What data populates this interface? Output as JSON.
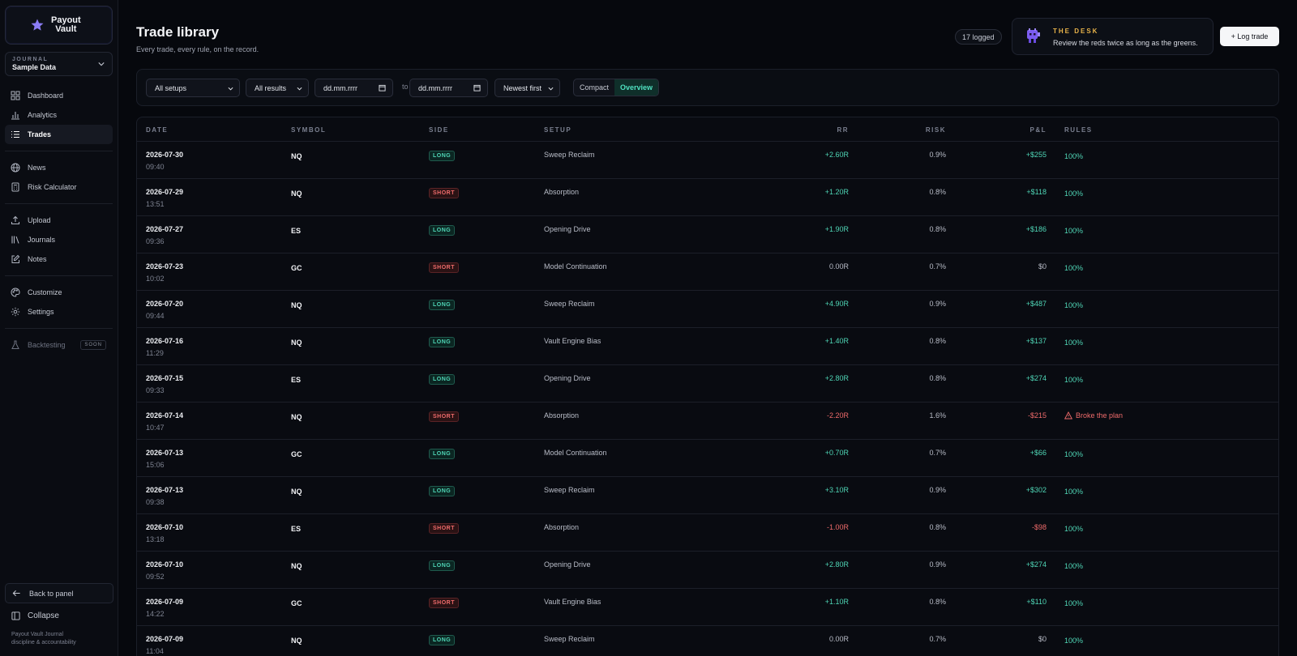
{
  "brand": {
    "line1": "Payout",
    "line2": "Vault"
  },
  "journal": {
    "label": "JOURNAL",
    "value": "Sample Data"
  },
  "nav": {
    "group1": [
      {
        "label": "Dashboard",
        "icon": "grid-icon"
      },
      {
        "label": "Analytics",
        "icon": "bar-chart-icon"
      },
      {
        "label": "Trades",
        "icon": "list-icon",
        "active": true
      }
    ],
    "group2": [
      {
        "label": "News",
        "icon": "globe-icon"
      },
      {
        "label": "Risk Calculator",
        "icon": "calculator-icon"
      }
    ],
    "group3": [
      {
        "label": "Upload",
        "icon": "upload-icon"
      },
      {
        "label": "Journals",
        "icon": "books-icon"
      },
      {
        "label": "Notes",
        "icon": "note-edit-icon"
      }
    ],
    "group4": [
      {
        "label": "Customize",
        "icon": "palette-icon"
      },
      {
        "label": "Settings",
        "icon": "gear-icon"
      }
    ],
    "backtesting": {
      "label": "Backtesting",
      "badge": "SOON"
    }
  },
  "back_label": "Back to panel",
  "collapse_label": "Collapse",
  "footer": {
    "line1": "Payout Vault Journal",
    "line2": "discipline & accountability"
  },
  "header": {
    "title": "Trade library",
    "subtitle": "Every trade, every rule, on the record.",
    "logged": "17 logged",
    "desk_title": "THE DESK",
    "desk_msg": "Review the reds twice as long as the greens.",
    "log_button": "+ Log trade"
  },
  "filters": {
    "setups": "All setups",
    "results": "All results",
    "date_from": "dd.mm.rrrr",
    "to": "to",
    "date_to": "dd.mm.rrrr",
    "sort": "Newest first",
    "view_compact": "Compact",
    "view_overview": "Overview"
  },
  "table": {
    "columns": [
      "DATE",
      "SYMBOL",
      "SIDE",
      "SETUP",
      "RR",
      "RISK",
      "P&L",
      "RULES"
    ],
    "rows": [
      {
        "date": "2026-07-30",
        "time": "09:40",
        "symbol": "NQ",
        "side": "LONG",
        "setup": "Sweep Reclaim",
        "rr": "+2.60R",
        "risk": "0.9%",
        "pnl": "+$255",
        "rules": "100%"
      },
      {
        "date": "2026-07-29",
        "time": "13:51",
        "symbol": "NQ",
        "side": "SHORT",
        "setup": "Absorption",
        "rr": "+1.20R",
        "risk": "0.8%",
        "pnl": "+$118",
        "rules": "100%"
      },
      {
        "date": "2026-07-27",
        "time": "09:36",
        "symbol": "ES",
        "side": "LONG",
        "setup": "Opening Drive",
        "rr": "+1.90R",
        "risk": "0.8%",
        "pnl": "+$186",
        "rules": "100%"
      },
      {
        "date": "2026-07-23",
        "time": "10:02",
        "symbol": "GC",
        "side": "SHORT",
        "setup": "Model Continuation",
        "rr": "0.00R",
        "risk": "0.7%",
        "pnl": "$0",
        "rules": "100%"
      },
      {
        "date": "2026-07-20",
        "time": "09:44",
        "symbol": "NQ",
        "side": "LONG",
        "setup": "Sweep Reclaim",
        "rr": "+4.90R",
        "risk": "0.9%",
        "pnl": "+$487",
        "rules": "100%"
      },
      {
        "date": "2026-07-16",
        "time": "11:29",
        "symbol": "NQ",
        "side": "LONG",
        "setup": "Vault Engine Bias",
        "rr": "+1.40R",
        "risk": "0.8%",
        "pnl": "+$137",
        "rules": "100%"
      },
      {
        "date": "2026-07-15",
        "time": "09:33",
        "symbol": "ES",
        "side": "LONG",
        "setup": "Opening Drive",
        "rr": "+2.80R",
        "risk": "0.8%",
        "pnl": "+$274",
        "rules": "100%"
      },
      {
        "date": "2026-07-14",
        "time": "10:47",
        "symbol": "NQ",
        "side": "SHORT",
        "setup": "Absorption",
        "rr": "-2.20R",
        "risk": "1.6%",
        "pnl": "-$215",
        "rules": "Broke the plan"
      },
      {
        "date": "2026-07-13",
        "time": "15:06",
        "symbol": "GC",
        "side": "LONG",
        "setup": "Model Continuation",
        "rr": "+0.70R",
        "risk": "0.7%",
        "pnl": "+$66",
        "rules": "100%"
      },
      {
        "date": "2026-07-13",
        "time": "09:38",
        "symbol": "NQ",
        "side": "LONG",
        "setup": "Sweep Reclaim",
        "rr": "+3.10R",
        "risk": "0.9%",
        "pnl": "+$302",
        "rules": "100%"
      },
      {
        "date": "2026-07-10",
        "time": "13:18",
        "symbol": "ES",
        "side": "SHORT",
        "setup": "Absorption",
        "rr": "-1.00R",
        "risk": "0.8%",
        "pnl": "-$98",
        "rules": "100%"
      },
      {
        "date": "2026-07-10",
        "time": "09:52",
        "symbol": "NQ",
        "side": "LONG",
        "setup": "Opening Drive",
        "rr": "+2.80R",
        "risk": "0.9%",
        "pnl": "+$274",
        "rules": "100%"
      },
      {
        "date": "2026-07-09",
        "time": "14:22",
        "symbol": "GC",
        "side": "SHORT",
        "setup": "Vault Engine Bias",
        "rr": "+1.10R",
        "risk": "0.8%",
        "pnl": "+$110",
        "rules": "100%"
      },
      {
        "date": "2026-07-09",
        "time": "11:04",
        "symbol": "NQ",
        "side": "LONG",
        "setup": "Sweep Reclaim",
        "rr": "0.00R",
        "risk": "0.7%",
        "pnl": "$0",
        "rules": "100%"
      }
    ]
  },
  "colors": {
    "positive": "#4fd6b6",
    "negative": "#ef6b6b",
    "accent_gold": "#e8b34a",
    "brand_purple": "#8b7cf6"
  }
}
